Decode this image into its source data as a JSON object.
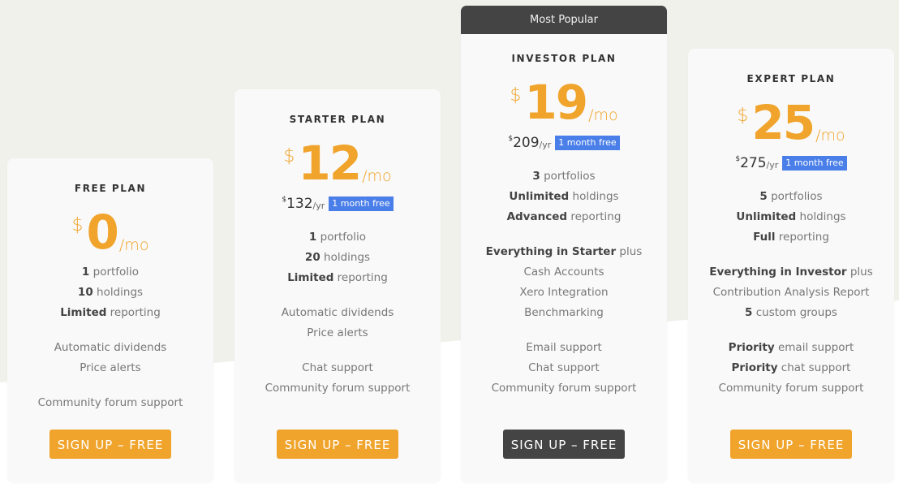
{
  "colors": {
    "accent_orange": "#f0a42c",
    "badge_blue": "#4a7ee8",
    "dark": "#444444",
    "background_top": "#f1f1ec",
    "card_bg": "#f9f9f9"
  },
  "plans": [
    {
      "name": "FREE PLAN",
      "currency": "$",
      "price": "0",
      "period": "/mo",
      "features": [
        [
          {
            "bold": "1",
            "text": " portfolio"
          },
          {
            "bold": "10",
            "text": " holdings"
          },
          {
            "bold": "Limited",
            "text": " reporting"
          }
        ],
        [
          {
            "bold": "",
            "text": "Automatic dividends"
          },
          {
            "bold": "",
            "text": "Price alerts"
          }
        ],
        [
          {
            "bold": "",
            "text": "Community forum support"
          }
        ]
      ],
      "button": "SIGN UP – FREE"
    },
    {
      "name": "STARTER PLAN",
      "currency": "$",
      "price": "12",
      "period": "/mo",
      "yearly_currency": "$",
      "yearly_price": "132",
      "yearly_period": "/yr",
      "badge": "1 month free",
      "features": [
        [
          {
            "bold": "1",
            "text": " portfolio"
          },
          {
            "bold": "20",
            "text": " holdings"
          },
          {
            "bold": "Limited",
            "text": " reporting"
          }
        ],
        [
          {
            "bold": "",
            "text": "Automatic dividends"
          },
          {
            "bold": "",
            "text": "Price alerts"
          }
        ],
        [
          {
            "bold": "",
            "text": "Chat support"
          },
          {
            "bold": "",
            "text": "Community forum support"
          }
        ]
      ],
      "button": "SIGN UP – FREE"
    },
    {
      "name": "INVESTOR PLAN",
      "highlight": "Most Popular",
      "currency": "$",
      "price": "19",
      "period": "/mo",
      "yearly_currency": "$",
      "yearly_price": "209",
      "yearly_period": "/yr",
      "badge": "1 month free",
      "features": [
        [
          {
            "bold": "3",
            "text": " portfolios"
          },
          {
            "bold": "Unlimited",
            "text": " holdings"
          },
          {
            "bold": "Advanced",
            "text": " reporting"
          }
        ],
        [
          {
            "bold": "Everything in Starter",
            "text": " plus"
          },
          {
            "bold": "",
            "text": "Cash Accounts"
          },
          {
            "bold": "",
            "text": "Xero Integration"
          },
          {
            "bold": "",
            "text": "Benchmarking"
          }
        ],
        [
          {
            "bold": "",
            "text": "Email support"
          },
          {
            "bold": "",
            "text": "Chat support"
          },
          {
            "bold": "",
            "text": "Community forum support"
          }
        ]
      ],
      "button": "SIGN UP – FREE"
    },
    {
      "name": "EXPERT PLAN",
      "currency": "$",
      "price": "25",
      "period": "/mo",
      "yearly_currency": "$",
      "yearly_price": "275",
      "yearly_period": "/yr",
      "badge": "1 month free",
      "features": [
        [
          {
            "bold": "5",
            "text": " portfolios"
          },
          {
            "bold": "Unlimited",
            "text": " holdings"
          },
          {
            "bold": "Full",
            "text": " reporting"
          }
        ],
        [
          {
            "bold": "Everything in Investor",
            "text": " plus"
          },
          {
            "bold": "",
            "text": "Contribution Analysis Report"
          },
          {
            "bold": "5",
            "text": " custom groups"
          }
        ],
        [
          {
            "bold": "Priority",
            "text": " email support"
          },
          {
            "bold": "Priority",
            "text": " chat support"
          },
          {
            "bold": "",
            "text": "Community forum support"
          }
        ]
      ],
      "button": "SIGN UP – FREE"
    }
  ]
}
